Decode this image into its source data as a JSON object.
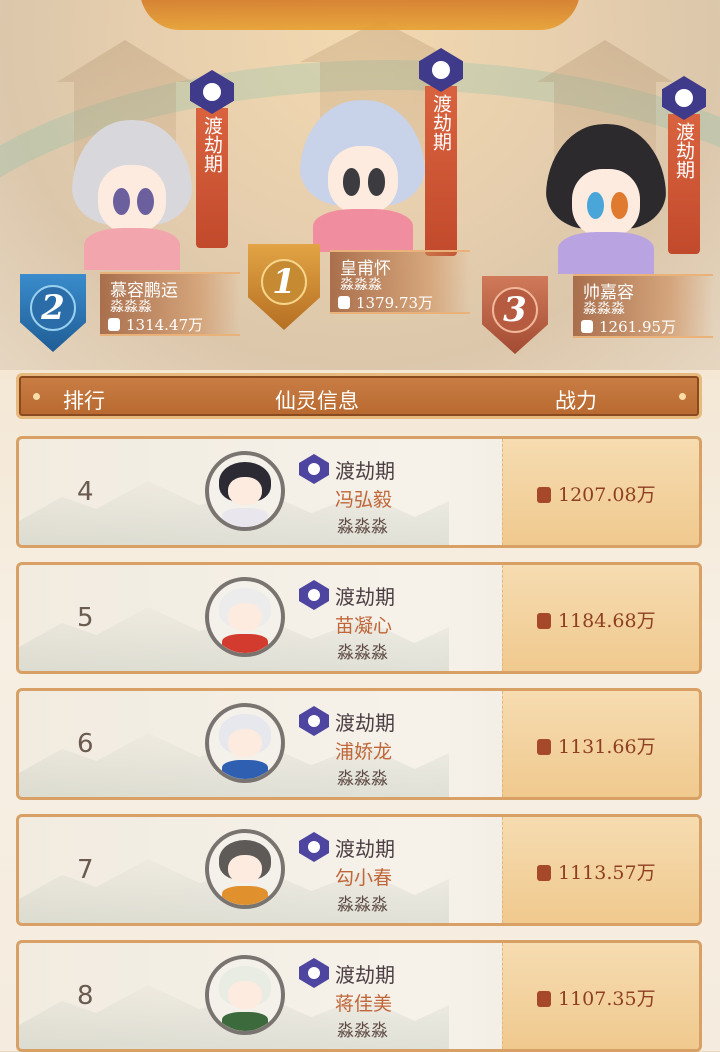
{
  "podium": [
    {
      "rank": "1",
      "name": "皇甫怀",
      "server": "淼淼淼",
      "power": "1379.73万",
      "realm": "渡劫期"
    },
    {
      "rank": "2",
      "name": "慕容鹏运",
      "server": "淼淼淼",
      "power": "1314.47万",
      "realm": "渡劫期"
    },
    {
      "rank": "3",
      "name": "帅嘉容",
      "server": "淼淼淼",
      "power": "1261.95万",
      "realm": "渡劫期"
    }
  ],
  "table": {
    "headers": {
      "rank": "排行",
      "info": "仙灵信息",
      "power": "战力"
    },
    "rows": [
      {
        "rank": "4",
        "realm": "渡劫期",
        "name": "冯弘毅",
        "server": "淼淼淼",
        "power": "1207.08万"
      },
      {
        "rank": "5",
        "realm": "渡劫期",
        "name": "苗凝心",
        "server": "淼淼淼",
        "power": "1184.68万"
      },
      {
        "rank": "6",
        "realm": "渡劫期",
        "name": "浦娇龙",
        "server": "淼淼淼",
        "power": "1131.66万"
      },
      {
        "rank": "7",
        "realm": "渡劫期",
        "name": "勾小春",
        "server": "淼淼淼",
        "power": "1113.57万"
      },
      {
        "rank": "8",
        "realm": "渡劫期",
        "name": "蒋佳美",
        "server": "淼淼淼",
        "power": "1107.35万"
      }
    ]
  },
  "colors": {
    "accent": "#c97e45",
    "rank1": "#c98a2f",
    "rank2": "#2f7ab8",
    "rank3": "#c0674a",
    "realm_badge": "#4d45a0"
  }
}
